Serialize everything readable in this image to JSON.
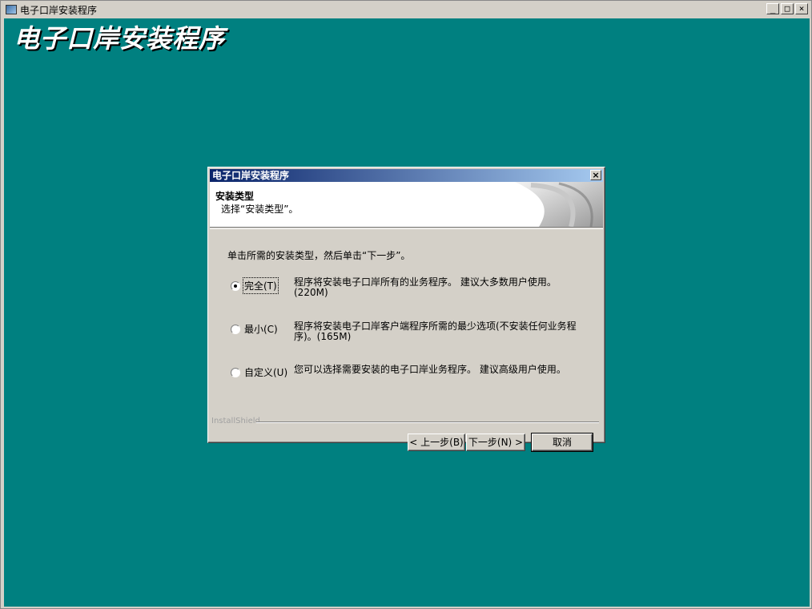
{
  "window": {
    "title": "电子口岸安装程序",
    "controls": [
      "_",
      "□",
      "×"
    ]
  },
  "banner": "电子口岸安装程序",
  "dialog": {
    "title": "电子口岸安装程序",
    "close": "×",
    "header_title": "安装类型",
    "header_subtitle": "选择“安装类型”。",
    "instruction": "单击所需的安装类型，然后单击“下一步”。",
    "options": [
      {
        "label": "完全(T)",
        "selected": true,
        "desc": "程序将安装电子口岸所有的业务程序。 建议大多数用户使用。(220M)"
      },
      {
        "label": "最小(C)",
        "selected": false,
        "desc": "程序将安装电子口岸客户端程序所需的最少选项(不安装任何业务程序)。(165M)"
      },
      {
        "label": "自定义(U)",
        "selected": false,
        "desc": "您可以选择需要安装的电子口岸业务程序。 建议高级用户使用。"
      }
    ],
    "brand": "InstallShield",
    "buttons": {
      "back": "< 上一步(B)",
      "next": "下一步(N) >",
      "cancel": "取消"
    }
  }
}
